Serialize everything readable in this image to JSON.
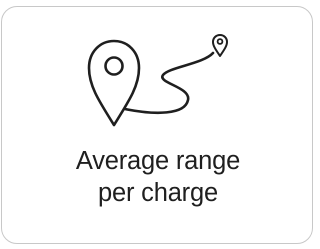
{
  "card": {
    "icon": "route-map-pin-icon",
    "caption_line_1": "Average range",
    "caption_line_2": "per charge"
  },
  "colors": {
    "text": "#1f1f1f",
    "icon_stroke": "#1f1f1f",
    "card_border": "#c8c8c8",
    "background": "#ffffff"
  }
}
